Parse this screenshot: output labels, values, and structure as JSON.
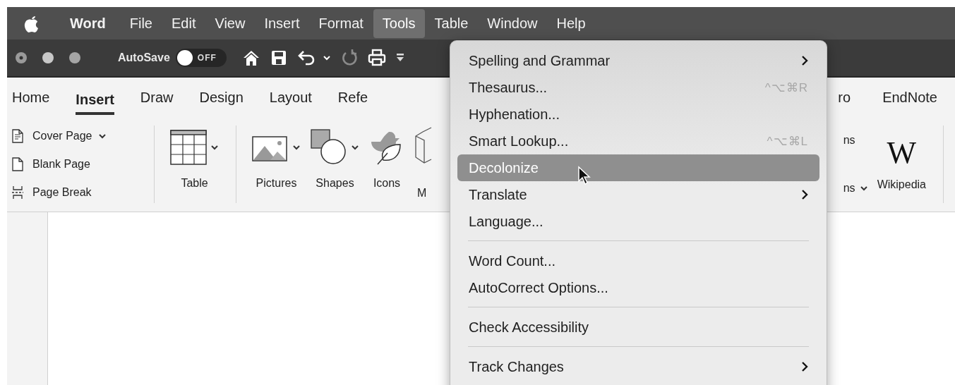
{
  "menubar": {
    "items": [
      {
        "label": "Word",
        "kind": "app",
        "selected": false
      },
      {
        "label": "File",
        "kind": "menu",
        "selected": false
      },
      {
        "label": "Edit",
        "kind": "menu",
        "selected": false
      },
      {
        "label": "View",
        "kind": "menu",
        "selected": false
      },
      {
        "label": "Insert",
        "kind": "menu",
        "selected": false
      },
      {
        "label": "Format",
        "kind": "menu",
        "selected": false
      },
      {
        "label": "Tools",
        "kind": "menu",
        "selected": true
      },
      {
        "label": "Table",
        "kind": "menu",
        "selected": false
      },
      {
        "label": "Window",
        "kind": "menu",
        "selected": false
      },
      {
        "label": "Help",
        "kind": "menu",
        "selected": false
      }
    ]
  },
  "toolbar": {
    "autosave": {
      "label": "AutoSave",
      "on": false,
      "state_text": "OFF"
    }
  },
  "ribbon": {
    "tabs": [
      {
        "label": "Home",
        "selected": false
      },
      {
        "label": "Insert",
        "selected": true
      },
      {
        "label": "Draw",
        "selected": false
      },
      {
        "label": "Design",
        "selected": false
      },
      {
        "label": "Layout",
        "selected": false
      },
      {
        "label": "Refe",
        "selected": false
      }
    ],
    "tabs_right": [
      {
        "label": "ro",
        "selected": false
      },
      {
        "label": "EndNote",
        "selected": false
      }
    ],
    "page_commands": [
      {
        "label": "Cover Page",
        "kind": "cover",
        "dropdown": true
      },
      {
        "label": "Blank Page",
        "kind": "blank",
        "dropdown": false
      },
      {
        "label": "Page Break",
        "kind": "break",
        "dropdown": false
      }
    ],
    "table": {
      "label": "Table",
      "dropdown": true
    },
    "media": [
      {
        "label": "Pictures",
        "kind": "pictures",
        "dropdown": true
      },
      {
        "label": "Shapes",
        "kind": "shapes",
        "dropdown": true
      },
      {
        "label": "Icons",
        "kind": "icons",
        "dropdown": false
      }
    ],
    "clipped_label": "M",
    "right_commands": [
      {
        "label": "ns",
        "dropdown": false
      },
      {
        "label": "ns",
        "dropdown": true
      }
    ],
    "wikipedia": {
      "logo": "W",
      "label": "Wikipedia"
    }
  },
  "tools_menu": {
    "items": [
      {
        "kind": "item",
        "label": "Spelling and Grammar",
        "submenu": true,
        "selected": false
      },
      {
        "kind": "item",
        "label": "Thesaurus...",
        "shortcut": "^⌥⌘R",
        "submenu": false,
        "selected": false
      },
      {
        "kind": "item",
        "label": "Hyphenation...",
        "submenu": false,
        "selected": false
      },
      {
        "kind": "item",
        "label": "Smart Lookup...",
        "shortcut": "^⌥⌘L",
        "submenu": false,
        "selected": false
      },
      {
        "kind": "item",
        "label": "Decolonize",
        "submenu": false,
        "selected": true
      },
      {
        "kind": "item",
        "label": "Translate",
        "submenu": true,
        "selected": false
      },
      {
        "kind": "item",
        "label": "Language...",
        "submenu": false,
        "selected": false
      },
      {
        "kind": "separator"
      },
      {
        "kind": "item",
        "label": "Word Count...",
        "submenu": false,
        "selected": false
      },
      {
        "kind": "item",
        "label": "AutoCorrect Options...",
        "submenu": false,
        "selected": false
      },
      {
        "kind": "separator"
      },
      {
        "kind": "item",
        "label": "Check Accessibility",
        "submenu": false,
        "selected": false
      },
      {
        "kind": "separator"
      },
      {
        "kind": "item",
        "label": "Track Changes",
        "submenu": true,
        "selected": false
      }
    ]
  }
}
